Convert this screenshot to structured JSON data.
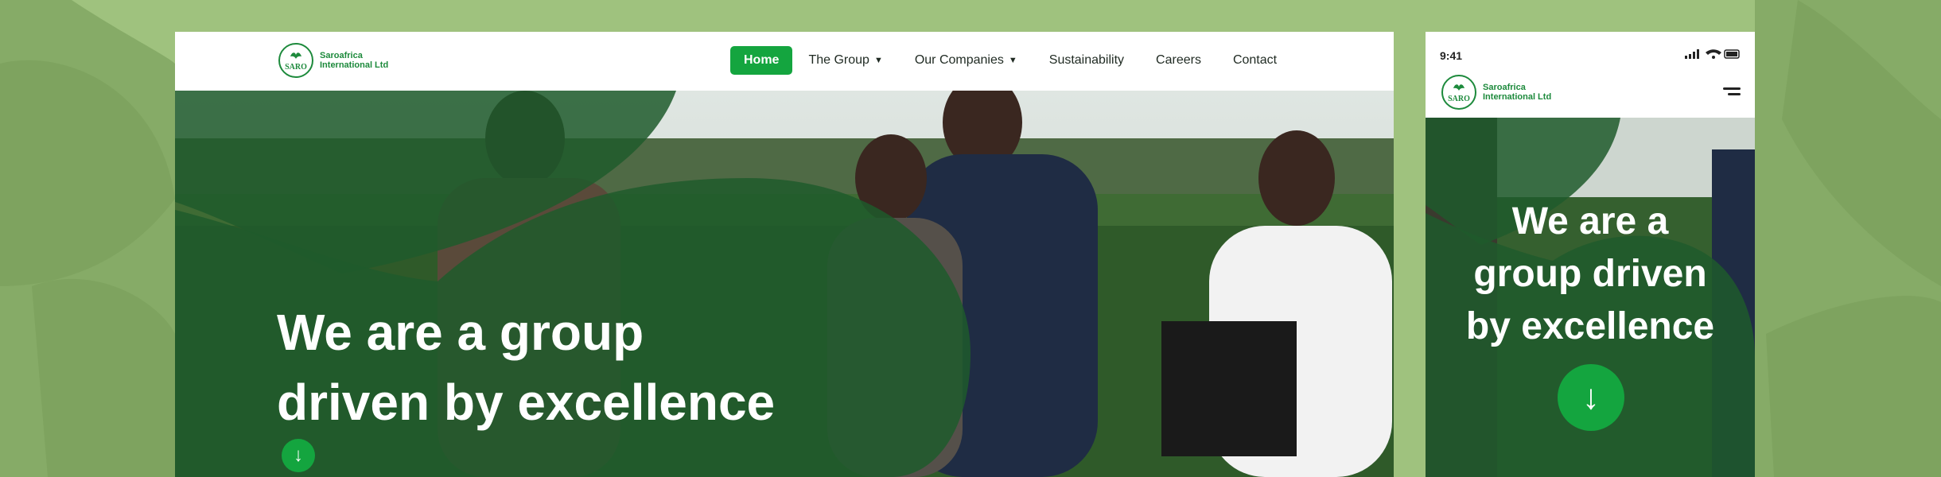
{
  "brand": {
    "name_line1": "Saroafrica",
    "name_line2": "International Ltd",
    "badge_text": "SARO"
  },
  "nav": {
    "items": [
      {
        "label": "Home",
        "active": true,
        "dropdown": false
      },
      {
        "label": "The Group",
        "active": false,
        "dropdown": true
      },
      {
        "label": "Our Companies",
        "active": false,
        "dropdown": true
      },
      {
        "label": "Sustainability",
        "active": false,
        "dropdown": false
      },
      {
        "label": "Careers",
        "active": false,
        "dropdown": false
      },
      {
        "label": "Contact",
        "active": false,
        "dropdown": false
      }
    ]
  },
  "hero": {
    "desktop_line1": "We are a group",
    "desktop_line2": "driven by excellence",
    "mobile_line1": "We are a",
    "mobile_line2": "group driven",
    "mobile_line3": "by excellence",
    "arrow_glyph": "↓"
  },
  "mobile": {
    "status_time": "9:41"
  },
  "colors": {
    "accent": "#14a53f",
    "overlay": "#1f5a2c",
    "background": "#9fc27e"
  }
}
